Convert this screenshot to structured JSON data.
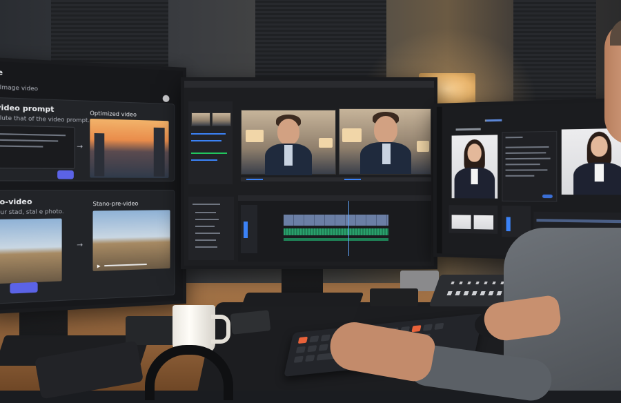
{
  "left_screen": {
    "app_fragment": "ne",
    "nav_tab": "Image video",
    "section1_title": "-video prompt",
    "section1_subtitle": "solute that of the video prompt.",
    "section1_output_label": "Optimized video",
    "section2_title": "-to-video",
    "section2_subtitle": "your stad, stal e photo.",
    "section2_output_label": "Stano-pre-video",
    "arrow": "→"
  },
  "icons": {
    "arrow": "arrow-right-icon",
    "play": "play-icon",
    "user": "avatar-icon"
  },
  "colors": {
    "accent": "#5b63e6",
    "audio_track": "#2aa06c",
    "video_track": "#6b7fa5",
    "lamp": "#e8b46b"
  }
}
